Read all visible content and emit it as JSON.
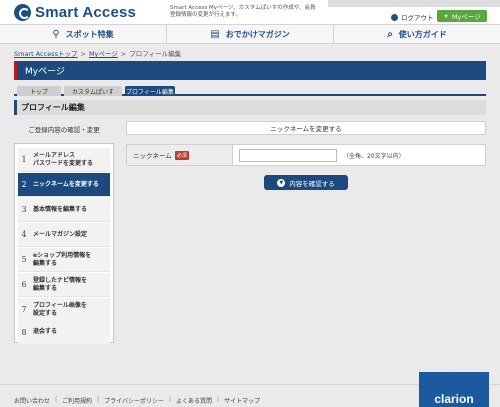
{
  "header": {
    "logo_text": "Smart Access",
    "description": "Smart Access Myページ、カスタムぱいすの作成や、会員登録情報の変更が行えます。",
    "logout_label": "ログアウト",
    "mypage_label": "Myページ"
  },
  "nav": {
    "items": [
      {
        "label": "スポット特集",
        "icon": "person-pin-icon"
      },
      {
        "label": "おでかけマガジン",
        "icon": "book-icon"
      },
      {
        "label": "使い方ガイド",
        "icon": "magnifier-icon"
      }
    ]
  },
  "breadcrumb": {
    "items": [
      "Smart Accessトップ",
      "Myページ",
      "プロフィール編集"
    ],
    "separator": ">"
  },
  "page_title": "Myページ",
  "tabs": [
    {
      "label": "トップ",
      "active": false
    },
    {
      "label": "カスタムぱいす",
      "active": false
    },
    {
      "label": "プロフィール編集",
      "active": true
    }
  ],
  "section_title": "プロフィール編集",
  "left_title": "ご登録内容の確認・変更",
  "steps": [
    {
      "num": "1",
      "label": "メールアドレス\nパスワードを変更する",
      "active": false
    },
    {
      "num": "2",
      "label": "ニックネームを変更する",
      "active": true
    },
    {
      "num": "3",
      "label": "基本情報を編集する",
      "active": false
    },
    {
      "num": "4",
      "label": "メールマガジン設定",
      "active": false
    },
    {
      "num": "5",
      "label": "eショップ利用情報を\n編集する",
      "active": false
    },
    {
      "num": "6",
      "label": "登録したナビ情報を\n編集する",
      "active": false
    },
    {
      "num": "7",
      "label": "プロフィール画像を\n設定する",
      "active": false
    },
    {
      "num": "8",
      "label": "退会する",
      "active": false
    }
  ],
  "form": {
    "title": "ニックネームを変更する",
    "nickname_label": "ニックネーム",
    "required_badge": "必須",
    "nickname_value": "",
    "hint": "（全角、20文字以内）",
    "confirm_label": "内容を確認する"
  },
  "footer": {
    "links": [
      "お問い合わせ",
      "ご利用規約",
      "プライバシーポリシー",
      "よくある質問",
      "サイトマップ"
    ],
    "brand": "clarion"
  },
  "colors": {
    "brand_blue": "#1c4a7e",
    "accent_red": "#b81c1c",
    "mypage_green": "#59a63c"
  }
}
